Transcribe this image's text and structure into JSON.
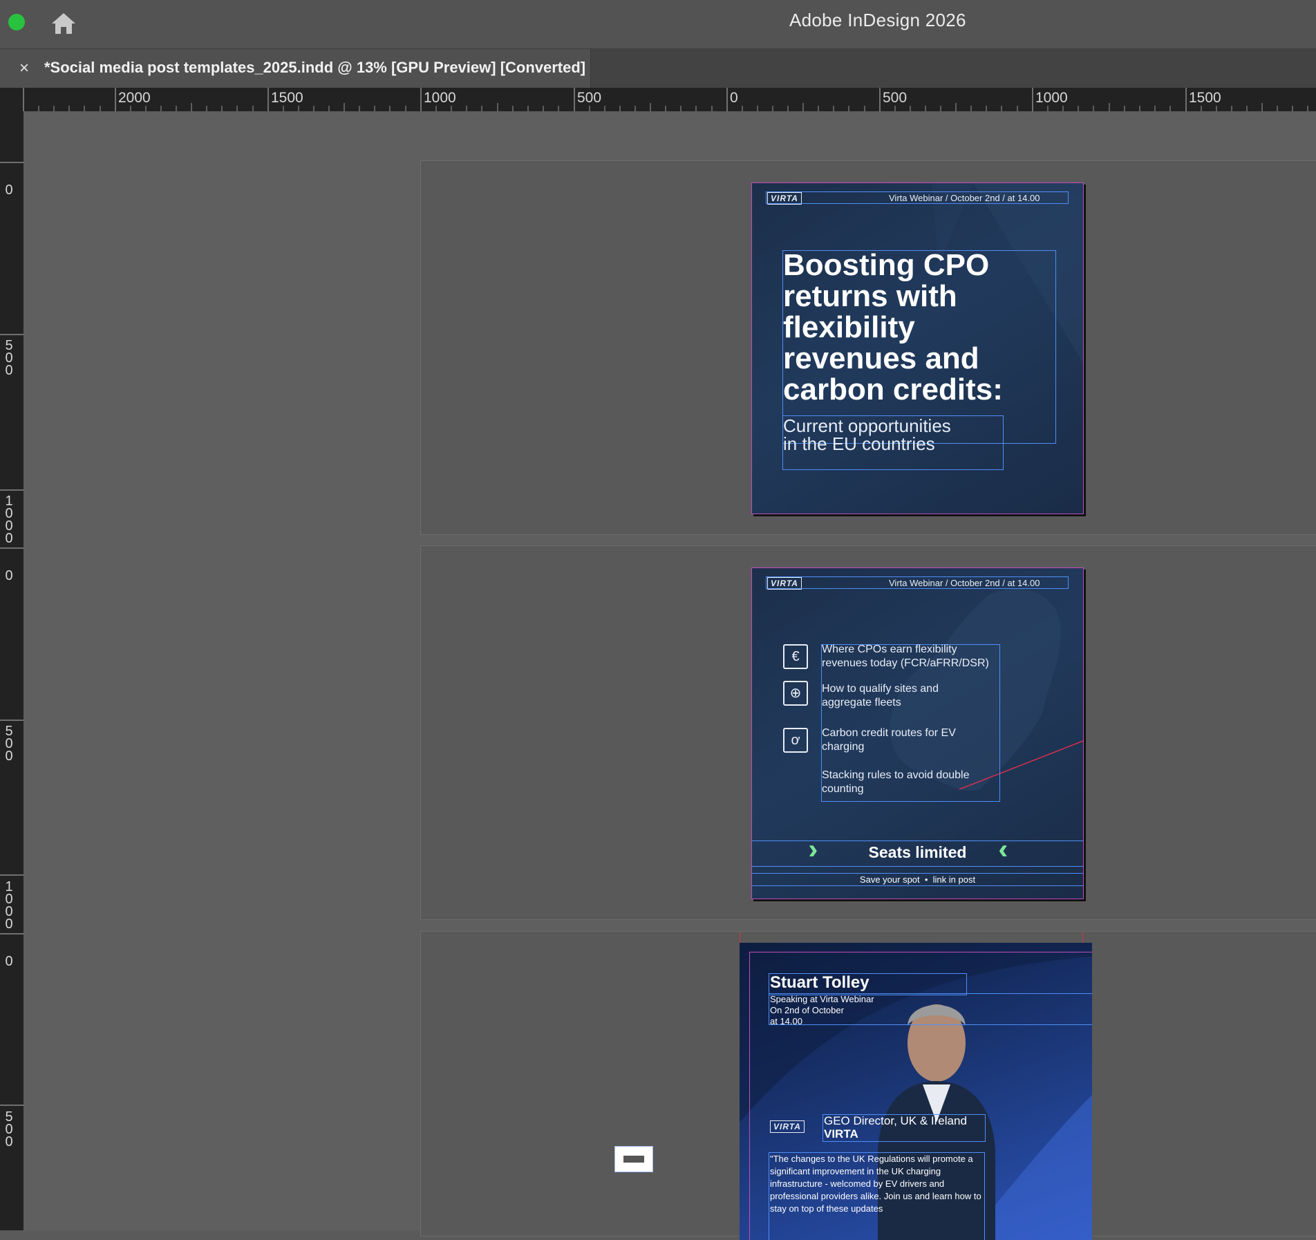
{
  "app": {
    "title": "Adobe InDesign 2026"
  },
  "document_tab": {
    "close_symbol": "×",
    "title": "*Social media post templates_2025.indd @ 13% [GPU Preview] [Converted]"
  },
  "ruler_h": [
    "2000",
    "1500",
    "1000",
    "500",
    "0",
    "500",
    "1000",
    "1500"
  ],
  "ruler_v": [
    "0",
    "500",
    "1000",
    "0",
    "500",
    "1000",
    "0",
    "500"
  ],
  "post1": {
    "logo": "VIRTA",
    "header": "Virta Webinar / October 2nd / at 14.00",
    "title": "Boosting CPO returns with flexibility revenues and carbon credits:",
    "subtitle": "Current opportunities in the EU countries"
  },
  "post2": {
    "logo": "VIRTA",
    "header": "Virta Webinar / October 2nd / at 14.00",
    "icons": [
      "euro-icon",
      "globe-icon",
      "leaf-icon"
    ],
    "bullets": [
      "Where CPOs earn flexibility revenues today (FCR/aFRR/DSR)",
      "How to qualify sites and aggregate fleets",
      "Carbon credit routes for EV charging",
      "Stacking rules to avoid double counting"
    ],
    "cta": "Seats limited",
    "footer": "Save your spot  •  link in post"
  },
  "post3": {
    "speaker_name": "Stuart Tolley",
    "details": [
      "Speaking at Virta Webinar",
      "On 2nd of October",
      "at 14.00"
    ],
    "logo": "VIRTA",
    "role": "GEO Director, UK & Ireland",
    "company": "VIRTA",
    "quote": "\"The changes to the UK Regulations will promote a significant improvement in the UK charging infrastructure - welcomed by EV drivers and professional providers alike. Join us and learn how to stay on top of these updates"
  }
}
